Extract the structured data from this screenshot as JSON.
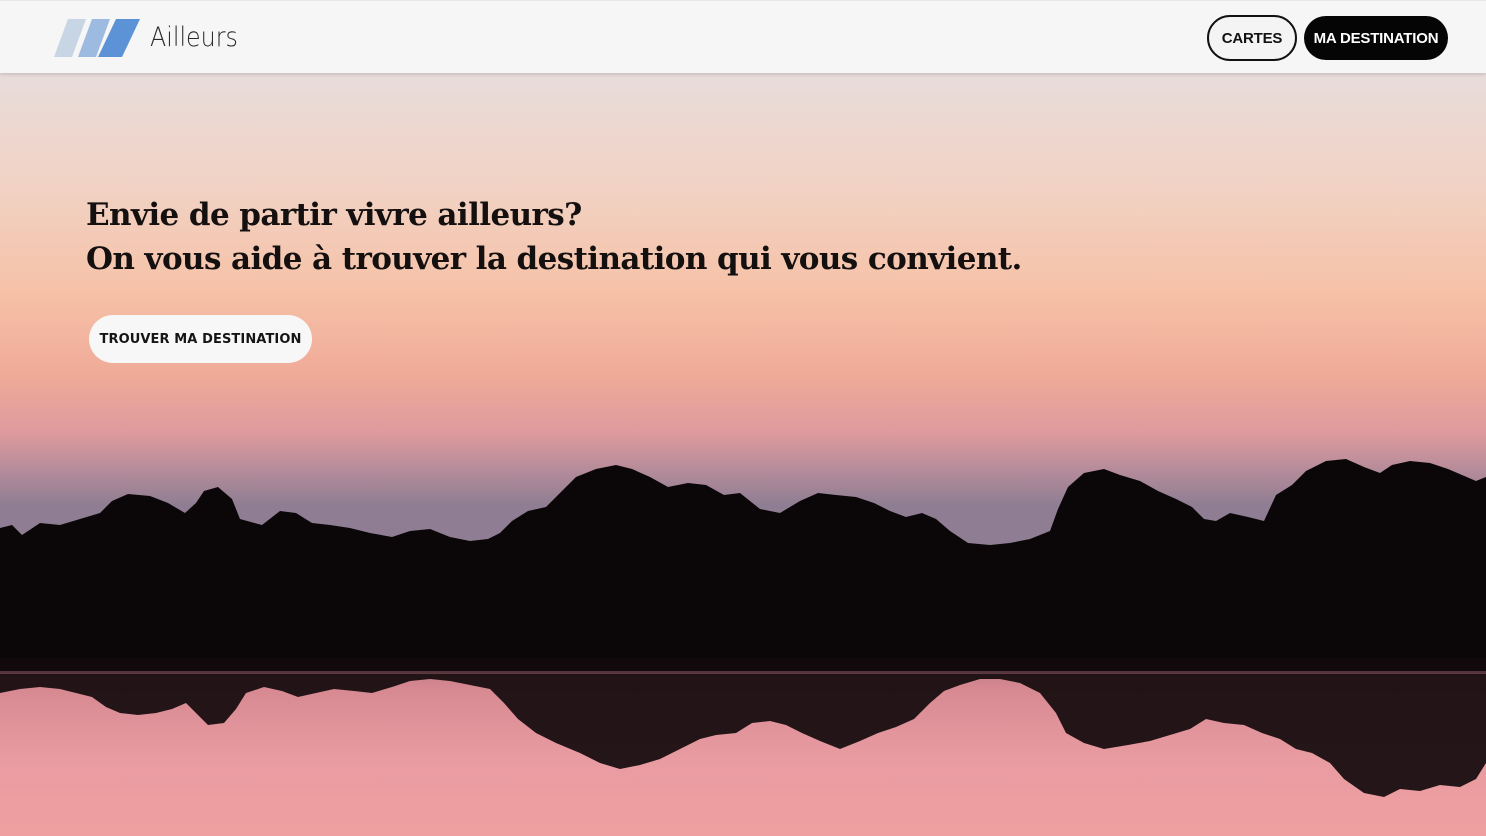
{
  "header": {
    "logo_text": "Ailleurs",
    "nav": {
      "cartes_label": "CARTES",
      "destination_label": "MA DESTINATION"
    }
  },
  "hero": {
    "headline_line1": "Envie de partir vivre ailleurs?",
    "headline_line2": "On vous aide à trouver la destination qui vous convient.",
    "cta_label": "TROUVER MA DESTINATION",
    "background": "sunset-lake-silhouette-image"
  },
  "colors": {
    "logo_stripe_light": "#c7d5e4",
    "logo_stripe_mid": "#9dbbe0",
    "logo_stripe_dark": "#5b93d6",
    "sky_top": "#e9ddda",
    "sky_mid": "#f6c2a8",
    "sky_low": "#e3949c",
    "water": "#e99ca2"
  },
  "icons": {
    "logo": "ailleurs-stripes-logo"
  }
}
